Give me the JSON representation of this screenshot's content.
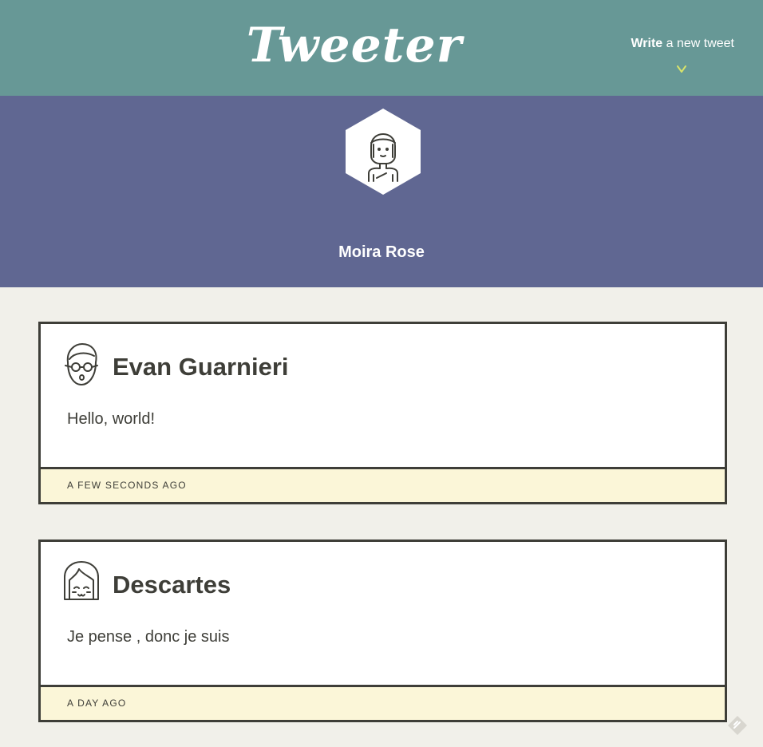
{
  "nav": {
    "brand": "Tweeter",
    "compose_bold": "Write",
    "compose_rest": " a new tweet"
  },
  "profile": {
    "name": "Moira Rose"
  },
  "tweets": [
    {
      "user": "Evan Guarnieri",
      "content": "Hello, world!",
      "time": "A FEW SECONDS AGO"
    },
    {
      "user": "Descartes",
      "content": "Je pense , donc je suis",
      "time": "A DAY AGO"
    }
  ],
  "colors": {
    "nav_bg": "#679896",
    "profile_bg": "#606792",
    "page_bg": "#f1f0ea",
    "footer_bg": "#fbf6d8",
    "text": "#3e3e38",
    "accent_arrow": "#d9e36a"
  }
}
